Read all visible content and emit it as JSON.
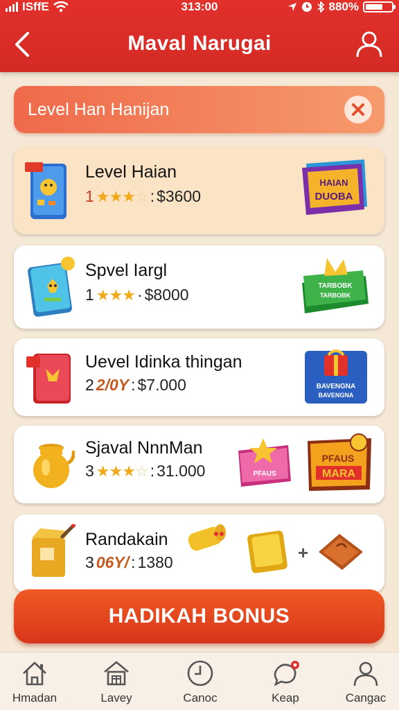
{
  "status_bar": {
    "carrier": "ISffE",
    "time": "313:00",
    "battery_text": "880%"
  },
  "header": {
    "title": "Maval Narugai"
  },
  "search": {
    "value": "Level Han Hanijan"
  },
  "items": [
    {
      "title": "Level Haian",
      "rank": "1",
      "stars": 3,
      "separator": ":",
      "price": "$3600",
      "thumb_icon": "blue-box-icon",
      "badge_icon": "purple-banner-badge-icon",
      "badge_text": "HAIAN DUOBA"
    },
    {
      "title": "Spvel Iargl",
      "rank": "1",
      "stars": 3,
      "separator": "·",
      "price": "$8000",
      "thumb_icon": "cyan-card-icon",
      "badge_icon": "green-banner-badge-icon",
      "badge_text": "TARBOBK"
    },
    {
      "title": "Uevel Idinka thingan",
      "rank": "2",
      "rate": "2/0Y",
      "separator": ":",
      "price": "$7.000",
      "thumb_icon": "red-box-icon",
      "badge_icon": "blue-gift-badge-icon",
      "badge_text": "BAVENGNA"
    },
    {
      "title": "Sjaval NnnMan",
      "rank": "3",
      "stars": 3,
      "separator": ":",
      "price": "31.000",
      "thumb_icon": "golden-jar-icon",
      "badge_icon": "pink-star-badge-icon",
      "badge_icon_2": "orange-banner-badge-icon",
      "badge_text": "PFAUS MARA"
    },
    {
      "title": "Randakain",
      "rank": "3",
      "rate": "06Y/",
      "separator": ":",
      "price": "1380",
      "thumb_icon": "yellow-box-icon",
      "extra_icon": "gold-scroll-icon",
      "reward_icon_1": "gold-bar-icon",
      "plus": "+",
      "reward_icon_2": "brown-chest-icon"
    }
  ],
  "bonus_button": {
    "label": "HADIKAH BONUS"
  },
  "bottom_nav": [
    {
      "label": "Hmadan",
      "icon": "home-icon"
    },
    {
      "label": "Lavey",
      "icon": "shop-icon"
    },
    {
      "label": "Canoc",
      "icon": "clock-icon"
    },
    {
      "label": "Keap",
      "icon": "chat-icon"
    },
    {
      "label": "Cangac",
      "icon": "user-icon"
    }
  ],
  "colors": {
    "primary_red": "#d42a25",
    "accent_orange": "#ef5a24",
    "background": "#f6e8d6",
    "star_gold": "#f0a91a"
  }
}
